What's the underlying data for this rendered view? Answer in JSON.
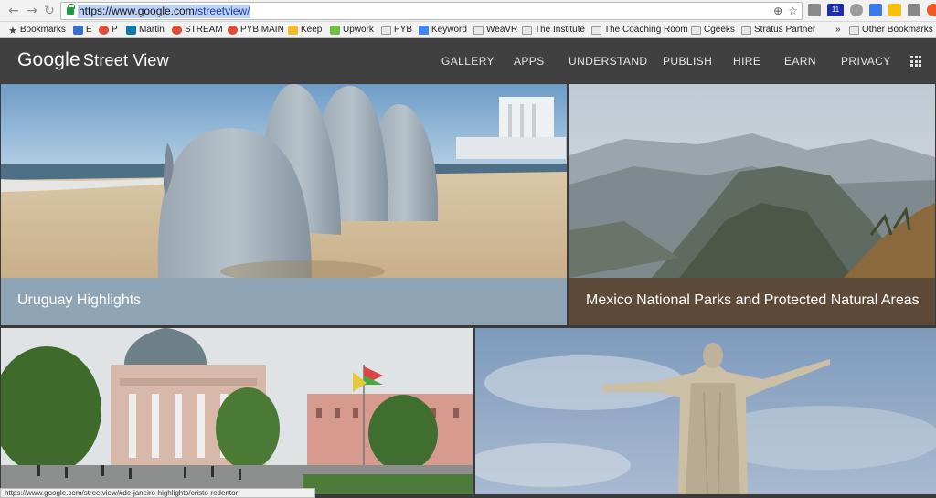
{
  "browser": {
    "url_scheme_host": "https://www.google.com",
    "url_path": "/streetview/",
    "extension_badge": "11",
    "bookmarks": [
      {
        "label": "Bookmarks",
        "icon": "star-icon"
      },
      {
        "label": "E",
        "icon": "mail-icon"
      },
      {
        "label": "P",
        "icon": "google-plus-icon"
      },
      {
        "label": "Martin",
        "icon": "linkedin-icon"
      },
      {
        "label": "STREAM",
        "icon": "google-plus-icon"
      },
      {
        "label": "PYB MAIN",
        "icon": "google-plus-icon"
      },
      {
        "label": "Keep",
        "icon": "keep-icon"
      },
      {
        "label": "Upwork",
        "icon": "upwork-icon"
      },
      {
        "label": "PYB",
        "icon": "folder-icon"
      },
      {
        "label": "Keyword",
        "icon": "adwords-icon"
      },
      {
        "label": "WeaVR",
        "icon": "folder-icon"
      },
      {
        "label": "The Institute",
        "icon": "folder-icon"
      },
      {
        "label": "The Coaching Room",
        "icon": "folder-icon"
      },
      {
        "label": "Cgeeks",
        "icon": "folder-icon"
      },
      {
        "label": "Stratus Partner",
        "icon": "folder-icon"
      }
    ],
    "overflow": "»",
    "other_bookmarks": "Other Bookmarks",
    "status_url": "https://www.google.com/streetview/#de-janeiro-highlights/cristo-redentor"
  },
  "site": {
    "logo_google": "Google",
    "logo_product": "Street View",
    "nav": [
      "GALLERY",
      "APPS",
      "UNDERSTAND",
      "PUBLISH",
      "HIRE",
      "EARN",
      "PRIVACY"
    ]
  },
  "tiles": [
    {
      "caption": "Uruguay Highlights",
      "caption_bg": "#8fa4b5"
    },
    {
      "caption": "Mexico National Parks and Protected Natural Areas",
      "caption_bg": "#5e4a38"
    },
    {
      "caption": ""
    },
    {
      "caption": ""
    }
  ]
}
